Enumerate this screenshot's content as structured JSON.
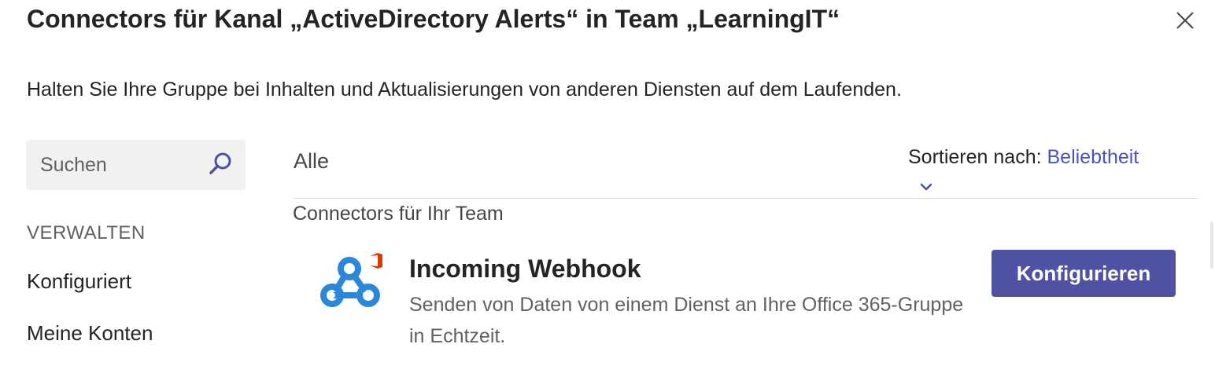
{
  "dialog": {
    "title": "Connectors für Kanal „ActiveDirectory Alerts“ in Team „LearningIT“",
    "subtitle": "Halten Sie Ihre Gruppe bei Inhalten und Aktualisierungen von anderen Diensten auf dem Laufenden.",
    "close_icon": "close-icon"
  },
  "sidebar": {
    "search": {
      "placeholder": "Suchen",
      "value": "",
      "icon": "search-icon"
    },
    "section_label": "VERWALTEN",
    "items": [
      {
        "label": "Konfiguriert"
      },
      {
        "label": "Meine Konten"
      }
    ]
  },
  "main": {
    "filter_label": "Alle",
    "sort": {
      "label": "Sortieren nach:",
      "value": "Beliebtheit",
      "icon": "chevron-down-icon"
    },
    "group_title": "Connectors für Ihr Team",
    "connectors": [
      {
        "name": "Incoming Webhook",
        "description": "Senden von Daten von einem Dienst an Ihre Office 365-Gruppe in Echtzeit.",
        "button_label": "Konfigurieren",
        "icon": "webhook-icon",
        "badge_icon": "office-icon"
      }
    ]
  },
  "colors": {
    "accent": "#4f52a2",
    "link": "#4b53bc",
    "webhook_blue": "#2b88d8",
    "office_red": "#d83b01",
    "search_bg": "#f1f1f1"
  }
}
